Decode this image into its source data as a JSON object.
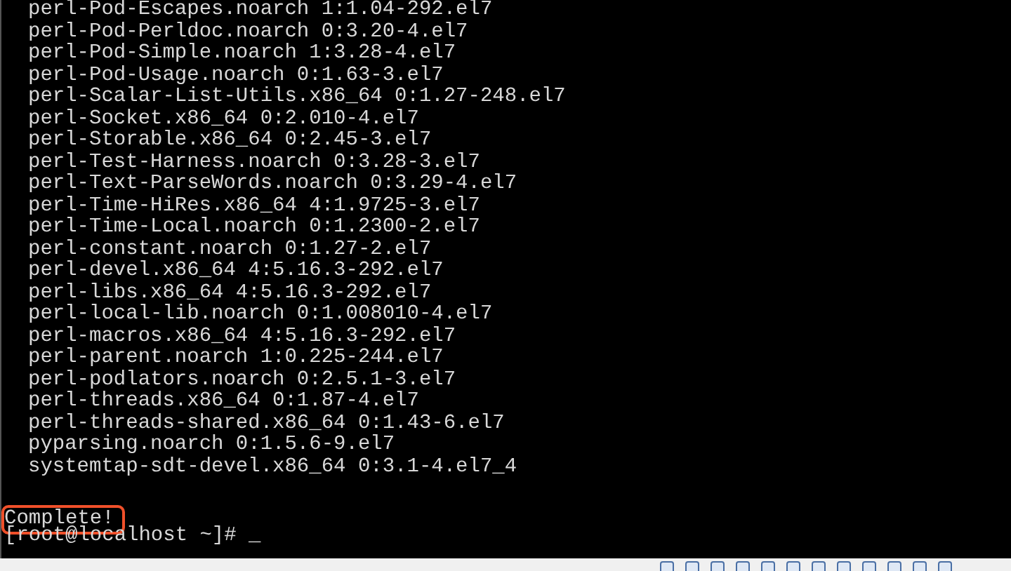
{
  "terminal": {
    "lines": [
      {
        "kind": "package",
        "text": "perl-Pod-Escapes.noarch 1:1.04-292.el7",
        "highlighted": false
      },
      {
        "kind": "package",
        "text": "perl-Pod-Perldoc.noarch 0:3.20-4.el7",
        "highlighted": false
      },
      {
        "kind": "package",
        "text": "perl-Pod-Simple.noarch 1:3.28-4.el7",
        "highlighted": false
      },
      {
        "kind": "package",
        "text": "perl-Pod-Usage.noarch 0:1.63-3.el7",
        "highlighted": false
      },
      {
        "kind": "package",
        "text": "perl-Scalar-List-Utils.x86_64 0:1.27-248.el7",
        "highlighted": false
      },
      {
        "kind": "package",
        "text": "perl-Socket.x86_64 0:2.010-4.el7",
        "highlighted": false
      },
      {
        "kind": "package",
        "text": "perl-Storable.x86_64 0:2.45-3.el7",
        "highlighted": false
      },
      {
        "kind": "package",
        "text": "perl-Test-Harness.noarch 0:3.28-3.el7",
        "highlighted": false
      },
      {
        "kind": "package",
        "text": "perl-Text-ParseWords.noarch 0:3.29-4.el7",
        "highlighted": false
      },
      {
        "kind": "package",
        "text": "perl-Time-HiRes.x86_64 4:1.9725-3.el7",
        "highlighted": false
      },
      {
        "kind": "package",
        "text": "perl-Time-Local.noarch 0:1.2300-2.el7",
        "highlighted": false
      },
      {
        "kind": "package",
        "text": "perl-constant.noarch 0:1.27-2.el7",
        "highlighted": false
      },
      {
        "kind": "package",
        "text": "perl-devel.x86_64 4:5.16.3-292.el7",
        "highlighted": false
      },
      {
        "kind": "package",
        "text": "perl-libs.x86_64 4:5.16.3-292.el7",
        "highlighted": false
      },
      {
        "kind": "package",
        "text": "perl-local-lib.noarch 0:1.008010-4.el7",
        "highlighted": false
      },
      {
        "kind": "package",
        "text": "perl-macros.x86_64 4:5.16.3-292.el7",
        "highlighted": false
      },
      {
        "kind": "package",
        "text": "perl-parent.noarch 1:0.225-244.el7",
        "highlighted": false
      },
      {
        "kind": "package",
        "text": "perl-podlators.noarch 0:2.5.1-3.el7",
        "highlighted": false
      },
      {
        "kind": "package",
        "text": "perl-threads.x86_64 0:1.87-4.el7",
        "highlighted": false
      },
      {
        "kind": "package",
        "text": "perl-threads-shared.x86_64 0:1.43-6.el7",
        "highlighted": false
      },
      {
        "kind": "package",
        "text": "pyparsing.noarch 0:1.5.6-9.el7",
        "highlighted": false
      },
      {
        "kind": "package",
        "text": "systemtap-sdt-devel.x86_64 0:3.1-4.el7_4",
        "highlighted": false
      },
      {
        "kind": "blank",
        "highlighted": false
      },
      {
        "kind": "status",
        "text": "Complete!",
        "highlighted": true
      },
      {
        "kind": "prompt",
        "text": "[root@localhost ~]# _",
        "highlighted": false
      }
    ]
  }
}
